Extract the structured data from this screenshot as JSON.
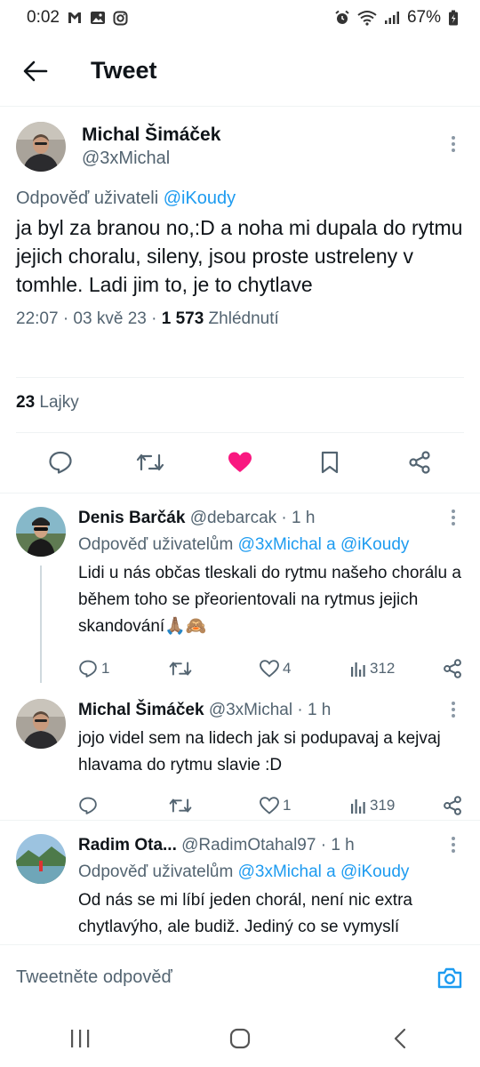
{
  "status_bar": {
    "time": "0:02",
    "battery": "67%",
    "left_icons": [
      "mail-icon",
      "image-icon",
      "instagram-icon"
    ],
    "right_icons": [
      "alarm-icon",
      "wifi-icon",
      "signal-icon",
      "battery-icon"
    ]
  },
  "header": {
    "title": "Tweet"
  },
  "main_tweet": {
    "author_name": "Michal Šimáček",
    "author_handle": "@3xMichal",
    "reply_prefix": "Odpověď uživateli",
    "reply_mention": "@iKoudy",
    "text": "ja byl za branou no,:D a noha mi dupala do rytmu jejich choralu, sileny, jsou proste ustreleny v tomhle. Ladi jim to, je to chytlave",
    "time_date": "22:07 · 03 kvě 23 · ",
    "views_count": "1 573",
    "views_label": " Zhlédnutí",
    "likes_count": "23",
    "likes_label": " Lajky"
  },
  "replies": [
    {
      "name": "Denis Barčák",
      "handle_time": "@debarcak · 1 h",
      "reply_prefix": "Odpověď uživatelům ",
      "mention1": "@3xMichal",
      "and": " a ",
      "mention2": "@iKoudy",
      "text": "Lidi u nás občas tleskali do rytmu našeho chorálu a během toho se přeorientovali na rytmus jejich skandování🙏🏽🙈",
      "replies": "1",
      "retweets": "",
      "likes": "4",
      "views": "312"
    },
    {
      "name": "Michal Šimáček",
      "handle_time": "@3xMichal · 1 h",
      "text": "jojo videl sem na lidech jak si podupavaj a kejvaj hlavama do rytmu slavie :D",
      "replies": "",
      "retweets": "",
      "likes": "1",
      "views": "319"
    },
    {
      "name": "Radim Ota...",
      "handle_time": "@RadimOtahal97 · 1 h",
      "reply_prefix": "Odpověď uživatelům ",
      "mention1": "@3xMichal",
      "and": " a ",
      "mention2": "@iKoudy",
      "text": "Od nás se mi líbí jeden chorál, není nic extra chytlavýho, ale budiž. Jediný co se vymyslí"
    }
  ],
  "composer": {
    "placeholder": "Tweetněte odpověď"
  },
  "colors": {
    "accent": "#1d9bf0",
    "like_pink": "#f91880",
    "text_secondary": "#536471"
  }
}
